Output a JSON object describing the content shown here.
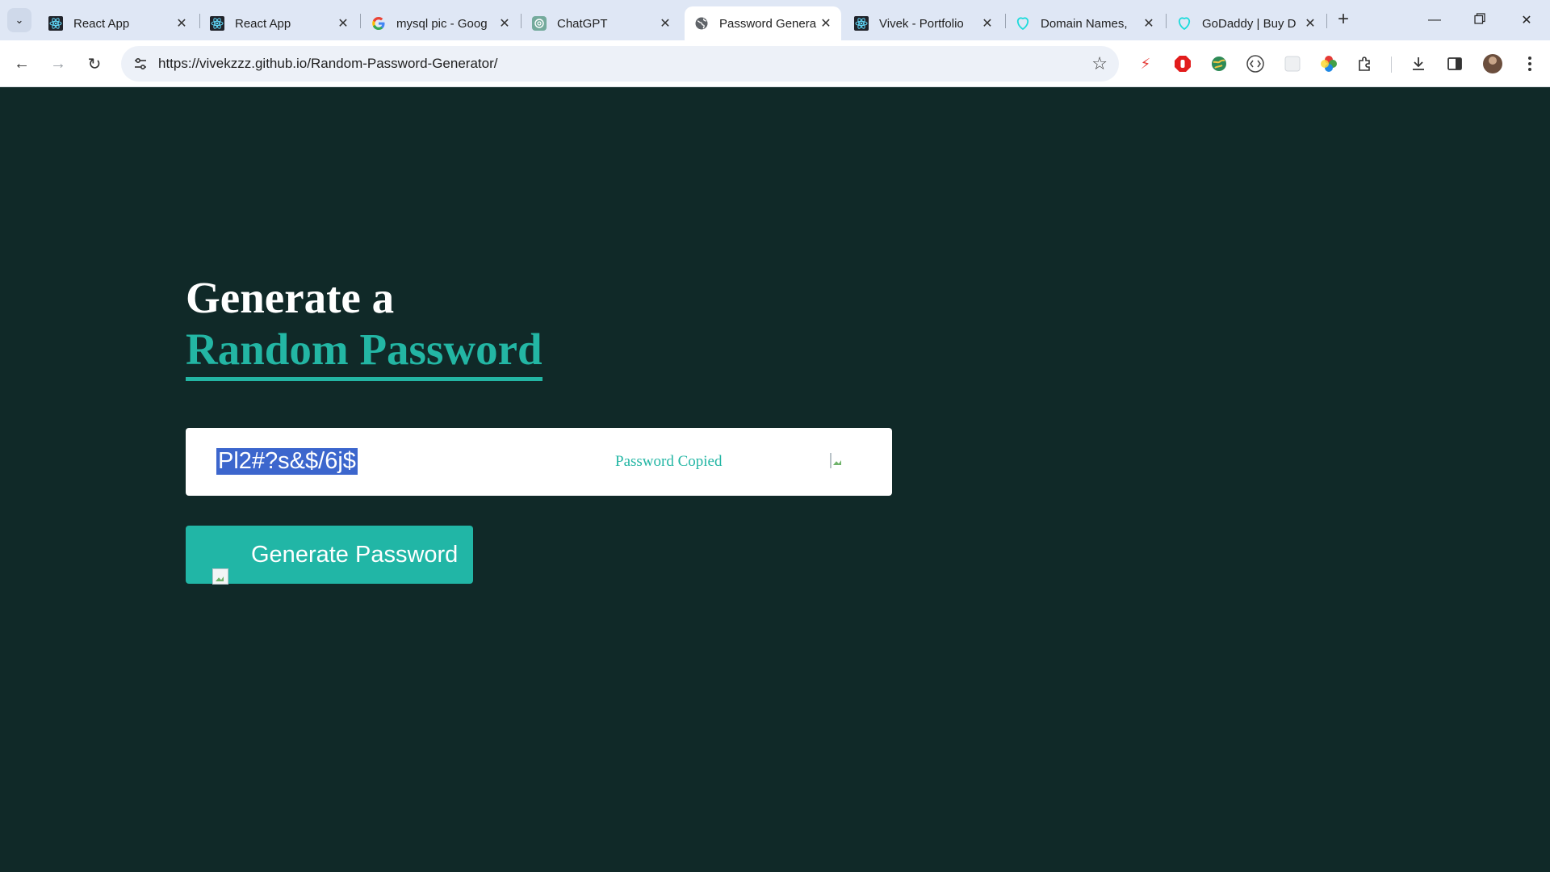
{
  "browser": {
    "tabs": [
      {
        "title": "React App",
        "icon": "react-icon",
        "active": false
      },
      {
        "title": "React App",
        "icon": "react-icon",
        "active": false
      },
      {
        "title": "mysql pic - Goog",
        "icon": "google-icon",
        "active": false
      },
      {
        "title": "ChatGPT",
        "icon": "chatgpt-icon",
        "active": false
      },
      {
        "title": "Password Genera",
        "icon": "globe-icon",
        "active": true
      },
      {
        "title": "Vivek - Portfolio",
        "icon": "react-icon",
        "active": false
      },
      {
        "title": "Domain Names,",
        "icon": "godaddy-icon",
        "active": false
      },
      {
        "title": "GoDaddy | Buy D",
        "icon": "godaddy-icon",
        "active": false
      }
    ],
    "url": "https://vivekzzz.github.io/Random-Password-Generator/"
  },
  "page": {
    "heading_line1": "Generate a",
    "heading_line2": "Random Password",
    "password_value": "Pl2#?s&$/6j$",
    "copied_message": "Password Copied",
    "generate_button_label": "Generate Password"
  },
  "colors": {
    "page_background": "#102928",
    "accent": "#23b6a4",
    "selection": "#3c66cd"
  }
}
